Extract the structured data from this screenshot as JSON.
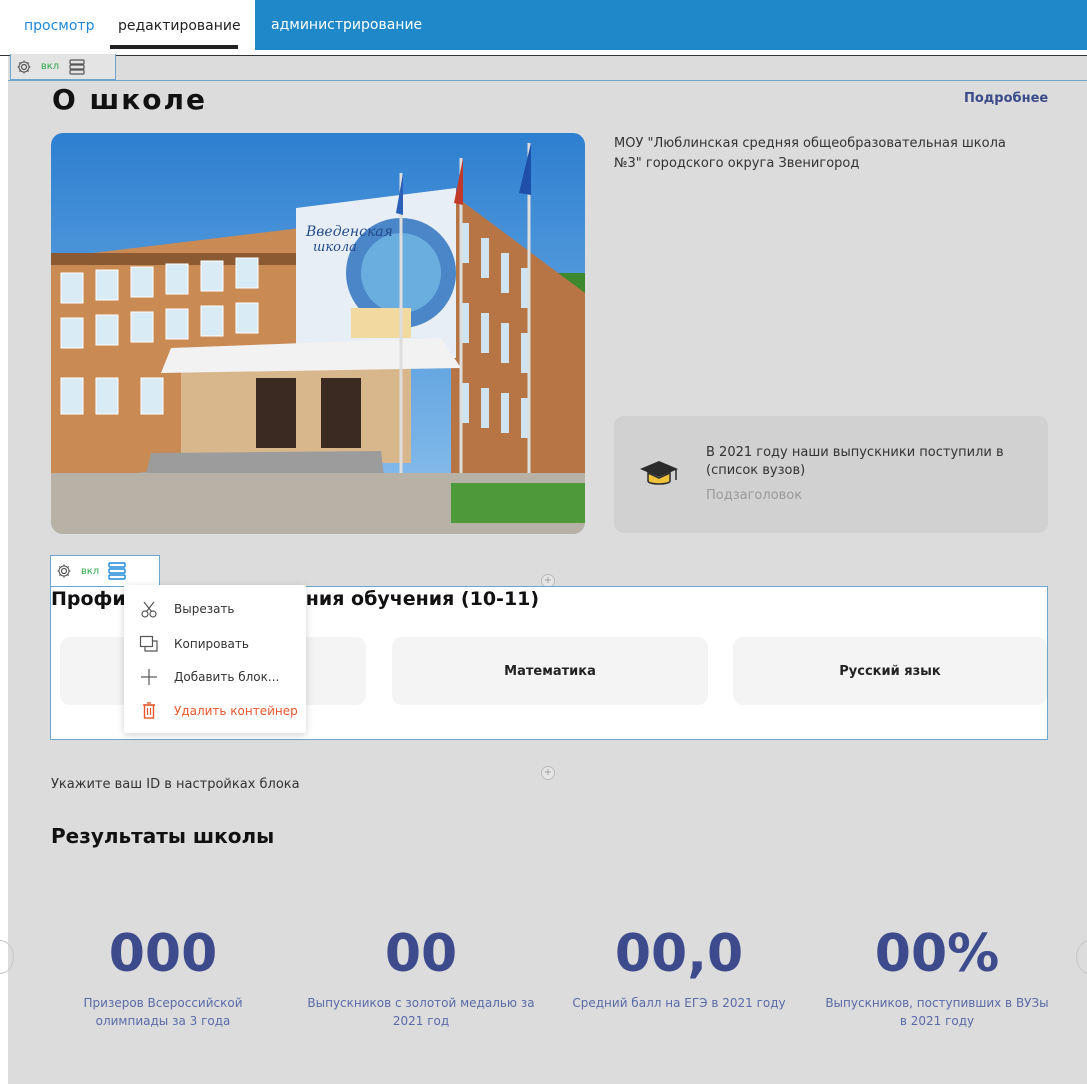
{
  "tabs": {
    "view": "просмотр",
    "edit": "редактирование",
    "admin": "администрирование"
  },
  "toolbar": {
    "on_label": "вкл"
  },
  "header": {
    "title": "О школе",
    "more_link": "Подробнее"
  },
  "about": {
    "description": "МОУ \"Люблинская средняя общеобразовательная школа №3\" городского округа Звенигород",
    "photo_sign": "Введенская школа",
    "vuz_card": {
      "title": "В 2021 году наши выпускники поступили в (список вузов)",
      "subtitle": "Подзаголовок",
      "icon": "graduation-cap-icon"
    }
  },
  "profile_section": {
    "title": "Профильные направления обучения (10-11)",
    "subjects": [
      "",
      "Математика",
      "Русский язык"
    ]
  },
  "context_menu": {
    "items": [
      {
        "label": "Вырезать",
        "icon": "scissors-icon"
      },
      {
        "label": "Копировать",
        "icon": "copy-icon"
      },
      {
        "label": "Добавить блок...",
        "icon": "plus-icon"
      },
      {
        "label": "Удалить контейнер",
        "icon": "trash-icon"
      }
    ]
  },
  "hint": "Укажите ваш ID в настройках блока",
  "results": {
    "title": "Результаты школы",
    "stats": [
      {
        "value": "000",
        "label": "Призеров Всероссийской олимпиады за 3 года"
      },
      {
        "value": "00",
        "label": "Выпускников с золотой медалью за 2021 год"
      },
      {
        "value": "00,0",
        "label": "Средний балл на ЕГЭ в 2021 году"
      },
      {
        "value": "00%",
        "label": "Выпускников, поступивших в ВУЗы в 2021 году"
      }
    ]
  },
  "colors": {
    "accent_blue": "#1e88c8",
    "stat_blue": "#3d4a8c",
    "on_green": "#2ea84a",
    "danger": "#e8572c"
  }
}
